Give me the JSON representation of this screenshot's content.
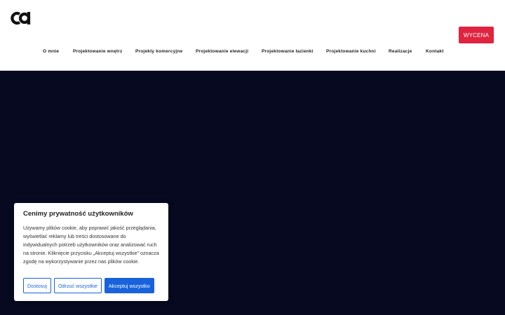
{
  "header": {
    "logo_name": "cd-logo",
    "cta_label": "WYCENA",
    "accent_color": "#e0243f"
  },
  "nav": {
    "items": [
      "O mnie",
      "Projektowanie wnętrz",
      "Projekty komercyjne",
      "Projektowanie elewacji",
      "Projektowanie łazienki",
      "Projektowanie kuchni",
      "Realizacje",
      "Kontakt"
    ]
  },
  "hero": {
    "background_color": "#070920"
  },
  "cookie": {
    "title": "Cenimy prywatność użytkowników",
    "text": "Używamy plików cookie, aby poprawić jakość przeglądania, wyświetlać reklamy lub treści dostosowane do indywidualnych potrzeb użytkowników oraz analizować ruch na stronie. Kliknięcie przycisku „Akceptuj wszystkie” oznacza zgodę na wykorzystywanie przez nas plików cookie.",
    "customize_label": "Dostosuj",
    "reject_label": "Odrzuć wszystkie",
    "accept_label": "Akceptuj wszystko",
    "button_color": "#1863dc"
  }
}
